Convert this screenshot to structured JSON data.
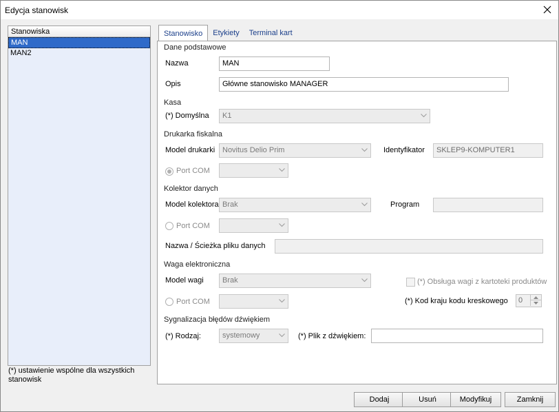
{
  "window": {
    "title": "Edycja stanowisk"
  },
  "list": {
    "header": "Stanowiska",
    "items": [
      {
        "label": "MAN",
        "selected": true
      },
      {
        "label": "MAN2",
        "selected": false
      }
    ],
    "note": "(*) ustawienie wspólne dla wszystkich stanowisk"
  },
  "tabs": [
    {
      "label": "Stanowisko",
      "active": true
    },
    {
      "label": "Etykiety",
      "active": false
    },
    {
      "label": "Terminal kart",
      "active": false
    }
  ],
  "dane": {
    "section": "Dane podstawowe",
    "nazwa_label": "Nazwa",
    "nazwa_value": "MAN",
    "opis_label": "Opis",
    "opis_value": "Główne stanowisko MANAGER"
  },
  "kasa": {
    "section": "Kasa",
    "domyslna_label": "(*) Domyślna",
    "domyslna_value": "K1"
  },
  "drukarka": {
    "section": "Drukarka fiskalna",
    "model_label": "Model drukarki",
    "model_value": "Novitus Delio Prim",
    "id_label": "Identyfikator",
    "id_value": "SKLEP9-KOMPUTER1",
    "port_label": "Port COM",
    "port_value": ""
  },
  "kolektor": {
    "section": "Kolektor danych",
    "model_label": "Model kolektora",
    "model_value": "Brak",
    "program_label": "Program",
    "program_value": "",
    "port_label": "Port COM",
    "port_value": "",
    "path_label": "Nazwa / Ścieżka pliku danych",
    "path_value": ""
  },
  "waga": {
    "section": "Waga elektroniczna",
    "model_label": "Model wagi",
    "model_value": "Brak",
    "obsluga_label": "(*) Obsługa wagi z kartoteki produktów",
    "port_label": "Port COM",
    "port_value": "",
    "kod_label": "(*) Kod kraju kodu kreskowego",
    "kod_value": "0"
  },
  "sygnal": {
    "section": "Sygnalizacja błędów dźwiękiem",
    "rodzaj_label": "(*) Rodzaj:",
    "rodzaj_value": "systemowy",
    "plik_label": "(*) Plik z dźwiękiem:",
    "plik_value": ""
  },
  "buttons": {
    "dodaj": "Dodaj",
    "usun": "Usuń",
    "modyfikuj": "Modyfikuj",
    "zamknij": "Zamknij"
  }
}
